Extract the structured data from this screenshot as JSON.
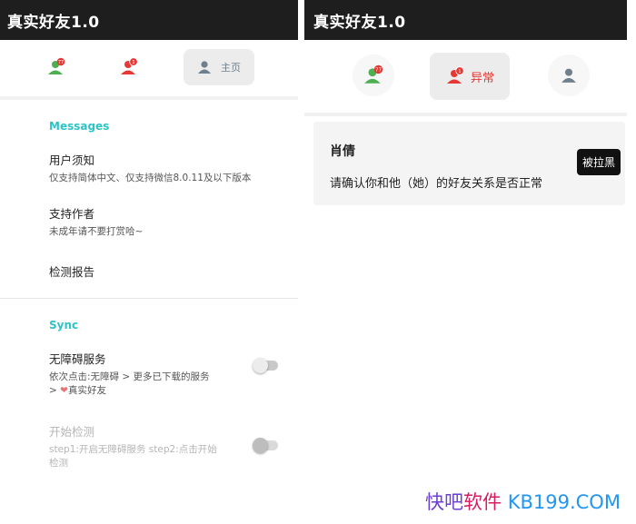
{
  "left_screen": {
    "app_title": "真实好友1.0",
    "nav": {
      "home_label": "主页",
      "badge_green": "77",
      "badge_red": "1"
    },
    "sections": [
      {
        "title": "Messages"
      },
      {
        "title": "Sync"
      }
    ],
    "items": [
      {
        "title": "用户须知",
        "subtitle": "仅支持简体中文、仅支持微信8.0.11及以下版本"
      },
      {
        "title": "支持作者",
        "subtitle": "未成年请不要打赏哈~"
      },
      {
        "title": "检测报告"
      }
    ],
    "accessibility": {
      "title": "无障碍服务",
      "subtitle_line1": "依次点击:无障碍 > 更多已下载的服务",
      "subtitle_line2_prefix": ">",
      "subtitle_line2_text": "真实好友"
    },
    "start_detect": {
      "title": "开始检测",
      "subtitle_line1": "step1:开启无障碍服务 step2:点击开始",
      "subtitle_line2": "检测"
    }
  },
  "right_screen": {
    "app_title": "真实好友1.0",
    "nav": {
      "abnormal_label": "异常",
      "badge_green": "77",
      "badge_red": "1"
    },
    "card": {
      "name": "肖倩",
      "message": "请确认你和他（她）的好友关系是否正常",
      "tag": "被拉黑"
    }
  },
  "watermark": {
    "part1": "快吧",
    "part2": "软件",
    "part3": "KB199.COM"
  },
  "colors": {
    "accent": "#2cc4c8",
    "green": "#4caf50",
    "red": "#e53935",
    "grey": "#6f7f8c",
    "appbar": "#1e1e1e"
  }
}
